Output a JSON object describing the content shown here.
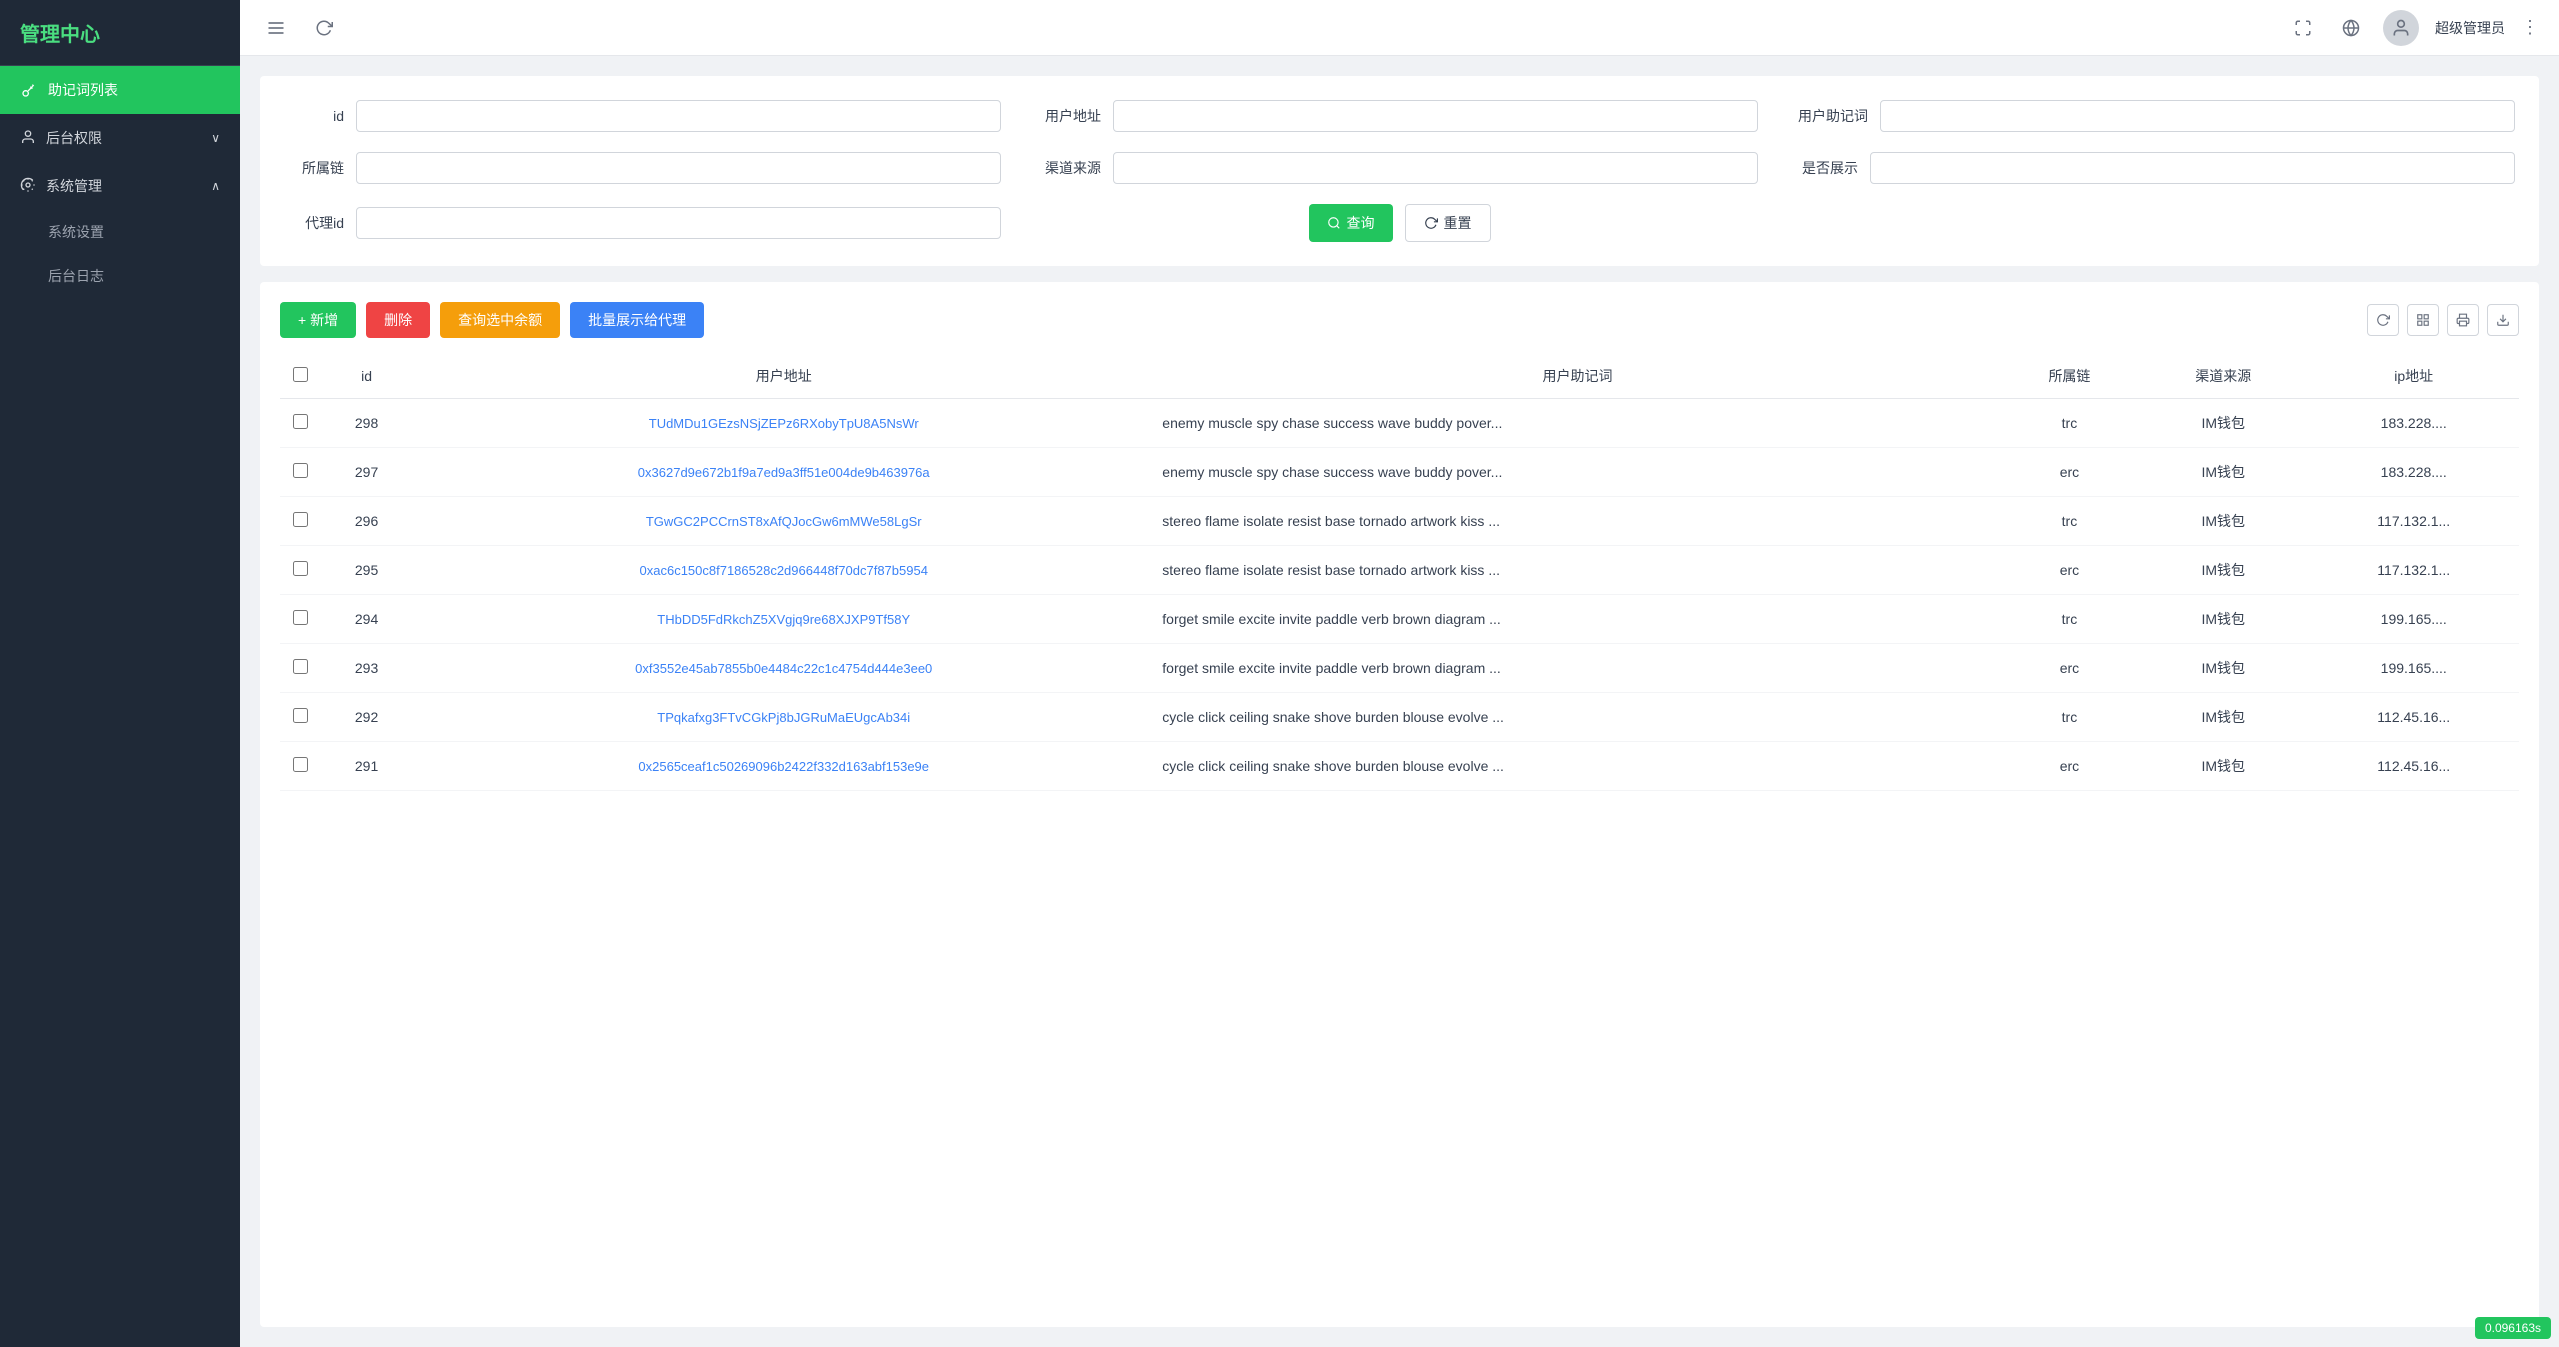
{
  "sidebar": {
    "logo": "管理中心",
    "items": [
      {
        "id": "mnemonic-list",
        "label": "助记词列表",
        "icon": "🔑",
        "active": true,
        "type": "item"
      },
      {
        "id": "backend-permission",
        "label": "后台权限",
        "icon": "👤",
        "type": "group",
        "expanded": false
      },
      {
        "id": "system-management",
        "label": "系统管理",
        "icon": "⚙️",
        "type": "group",
        "expanded": true,
        "children": [
          {
            "id": "system-settings",
            "label": "系统设置"
          },
          {
            "id": "backend-log",
            "label": "后台日志"
          }
        ]
      }
    ]
  },
  "header": {
    "username": "超级管理员",
    "more_icon": "⋮"
  },
  "filter": {
    "fields": [
      {
        "id": "id",
        "label": "id",
        "placeholder": ""
      },
      {
        "id": "user-address",
        "label": "用户地址",
        "placeholder": ""
      },
      {
        "id": "user-mnemonic",
        "label": "用户助记词",
        "placeholder": ""
      },
      {
        "id": "chain",
        "label": "所属链",
        "placeholder": ""
      },
      {
        "id": "channel-source",
        "label": "渠道来源",
        "placeholder": ""
      },
      {
        "id": "show-status",
        "label": "是否展示",
        "placeholder": ""
      },
      {
        "id": "agent-id",
        "label": "代理id",
        "placeholder": ""
      }
    ],
    "query_btn": "查询",
    "reset_btn": "重置"
  },
  "toolbar": {
    "add_btn": "+ 新增",
    "delete_btn": "删除",
    "query_balance_btn": "查询选中余额",
    "batch_show_btn": "批量展示给代理"
  },
  "table": {
    "columns": [
      "id",
      "用户地址",
      "用户助记词",
      "所属链",
      "渠道来源",
      "ip地址"
    ],
    "rows": [
      {
        "id": "298",
        "address": "TUdMDu1GEzsNSjZEPz6RXobyTpU8A5NsWr",
        "mnemonic": "enemy muscle spy chase success wave buddy pover...",
        "chain": "trc",
        "channel": "IM钱包",
        "ip": "183.228...."
      },
      {
        "id": "297",
        "address": "0x3627d9e672b1f9a7ed9a3ff51e004de9b463976a",
        "mnemonic": "enemy muscle spy chase success wave buddy pover...",
        "chain": "erc",
        "channel": "IM钱包",
        "ip": "183.228...."
      },
      {
        "id": "296",
        "address": "TGwGC2PCCrnST8xAfQJocGw6mMWe58LgSr",
        "mnemonic": "stereo flame isolate resist base tornado artwork kiss ...",
        "chain": "trc",
        "channel": "IM钱包",
        "ip": "117.132.1..."
      },
      {
        "id": "295",
        "address": "0xac6c150c8f7186528c2d966448f70dc7f87b5954",
        "mnemonic": "stereo flame isolate resist base tornado artwork kiss ...",
        "chain": "erc",
        "channel": "IM钱包",
        "ip": "117.132.1..."
      },
      {
        "id": "294",
        "address": "THbDD5FdRkchZ5XVgjq9re68XJXP9Tf58Y",
        "mnemonic": "forget smile excite invite paddle verb brown diagram ...",
        "chain": "trc",
        "channel": "IM钱包",
        "ip": "199.165...."
      },
      {
        "id": "293",
        "address": "0xf3552e45ab7855b0e4484c22c1c4754d444e3ee0",
        "mnemonic": "forget smile excite invite paddle verb brown diagram ...",
        "chain": "erc",
        "channel": "IM钱包",
        "ip": "199.165...."
      },
      {
        "id": "292",
        "address": "TPqkafxg3FTvCGkPj8bJGRuMaEUgcAb34i",
        "mnemonic": "cycle click ceiling snake shove burden blouse evolve ...",
        "chain": "trc",
        "channel": "IM钱包",
        "ip": "112.45.16..."
      },
      {
        "id": "291",
        "address": "0x2565ceaf1c50269096b2422f332d163abf153e9e",
        "mnemonic": "cycle click ceiling snake shove burden blouse evolve ...",
        "chain": "erc",
        "channel": "IM钱包",
        "ip": "112.45.16..."
      }
    ]
  },
  "status": {
    "value": "0.096163s"
  }
}
